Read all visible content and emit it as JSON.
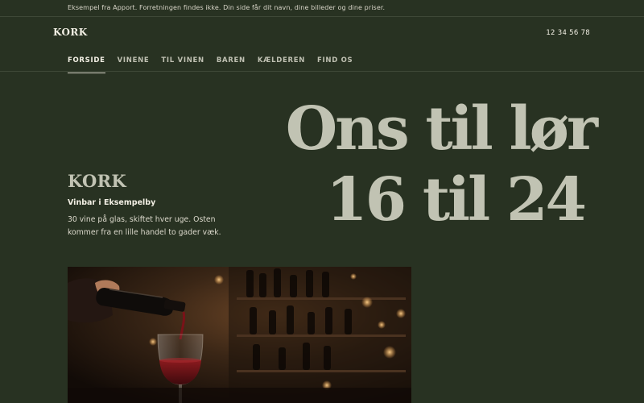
{
  "notice": "Eksempel fra Apport. Forretningen findes ikke. Din side får dit navn, dine billeder og dine priser.",
  "header": {
    "logo": "KORK",
    "phone": "12 34 56 78"
  },
  "nav": {
    "items": [
      {
        "label": "FORSIDE",
        "active": true
      },
      {
        "label": "VINENE"
      },
      {
        "label": "TIL VINEN"
      },
      {
        "label": "BAREN"
      },
      {
        "label": "KÆLDEREN"
      },
      {
        "label": "FIND OS"
      }
    ]
  },
  "hero": {
    "line1": "Ons til lør",
    "line2": "16 til 24"
  },
  "intro": {
    "brand": "KORK",
    "subtitle": "Vinbar i Eksempelby",
    "description": "30 vine på glas, skiftet hver uge. Osten kommer fra en lille handel to gader væk."
  },
  "colors": {
    "background": "#283222",
    "headline": "#c1c3b3",
    "text": "#f2efe4"
  }
}
